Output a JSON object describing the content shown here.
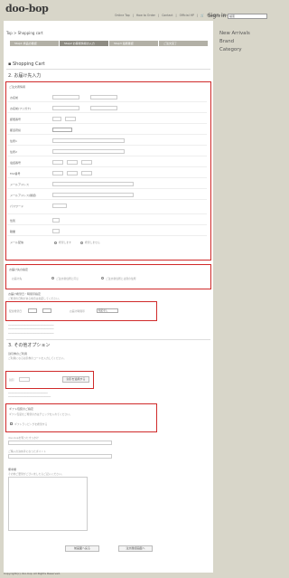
{
  "header": {
    "logo": "doo-bop",
    "nav": [
      "Online Top",
      "How to Order",
      "Contact",
      "Official HP",
      "Shopping Cart"
    ],
    "signin": "Sign in",
    "search_value": "検索"
  },
  "sidebar": {
    "items": [
      "New Arrivals",
      "Brand",
      "Category"
    ]
  },
  "breadcrumb": "Top > Shopping cart",
  "steps": [
    "Step1 商品の確認",
    "Step2 お客様情報の入力",
    "Step3 最終確認",
    "ご注文完了"
  ],
  "page_title": "Shopping Cart",
  "section2": {
    "title": "2. お届け先入力",
    "subhead": "ご注文者情報",
    "rows": [
      "お名前",
      "お名前(フリガナ)",
      "郵便番号",
      "都道府県",
      "住所1",
      "住所2",
      "電話番号",
      "FAX番号",
      "メールアドレス",
      "メールアドレス(確認)",
      "パスワード",
      "性別",
      "職業",
      "メール配信"
    ],
    "radio_yes": "希望します",
    "radio_no": "希望しません"
  },
  "delivery": {
    "title": "お届け先の指定",
    "label": "お届け先",
    "opt1": "ご注文者住所と同じ",
    "opt2": "ご注文者住所とは別の住所"
  },
  "datetime": {
    "title": "お届け希望日・時間帯指定",
    "note": "ご希望の日時がある場合は指定してください。",
    "date_label": "配達希望日",
    "time_label": "お届け時間帯",
    "time_value": "指定なし"
  },
  "section3": {
    "title": "3. その他オプション",
    "coupon_title": "割引券のご利用",
    "coupon_note": "ご利用になる割引券のコードを入力してください。",
    "coupon_label": "割引",
    "coupon_button": "割引を適用する",
    "gift_title": "ギフト包装のご指定",
    "gift_note": "ギフト包装をご希望の方はチェックを入れてください。",
    "gift_check": "ギフトラッピングを希望する",
    "q1": "doo-bopを知ったきっかけ",
    "q2": "ご購入の決め手になったポイント",
    "remarks_title": "備考欄",
    "remarks_note": "その他ご要望がございましたらご記入ください。"
  },
  "buttons": {
    "back": "前画面へ戻る",
    "next": "注文確認画面へ"
  },
  "footer": "Copyright(c) doo-bop All Rights Reserved."
}
